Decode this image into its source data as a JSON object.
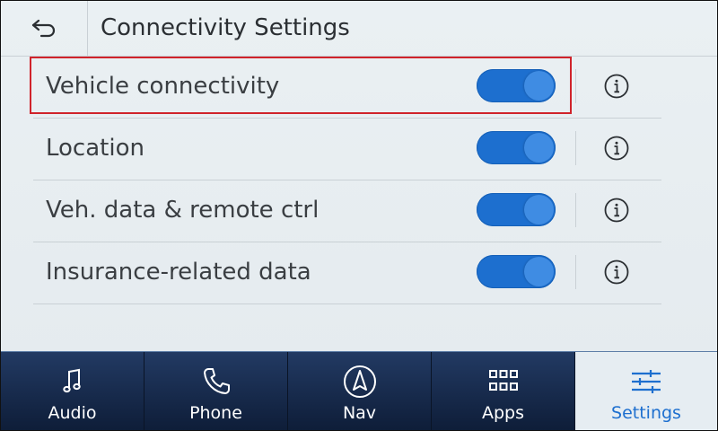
{
  "header": {
    "back_icon": "back-arrow-icon",
    "title": "Connectivity Settings"
  },
  "rows": [
    {
      "label": "Vehicle connectivity",
      "enabled": true,
      "highlighted": true
    },
    {
      "label": "Location",
      "enabled": true,
      "highlighted": false
    },
    {
      "label": "Veh. data & remote ctrl",
      "enabled": true,
      "highlighted": false
    },
    {
      "label": "Insurance-related data",
      "enabled": true,
      "highlighted": false
    }
  ],
  "nav": {
    "items": [
      {
        "label": "Audio",
        "icon": "music-note-icon",
        "active": false
      },
      {
        "label": "Phone",
        "icon": "phone-icon",
        "active": false
      },
      {
        "label": "Nav",
        "icon": "navigation-icon",
        "active": false
      },
      {
        "label": "Apps",
        "icon": "apps-grid-icon",
        "active": false
      },
      {
        "label": "Settings",
        "icon": "settings-sliders-icon",
        "active": true
      }
    ]
  },
  "colors": {
    "toggle_on": "#1d6fcf",
    "highlight": "#d0232b",
    "nav_background": "#1a2c4e",
    "active_nav_text": "#1d6fcf"
  }
}
